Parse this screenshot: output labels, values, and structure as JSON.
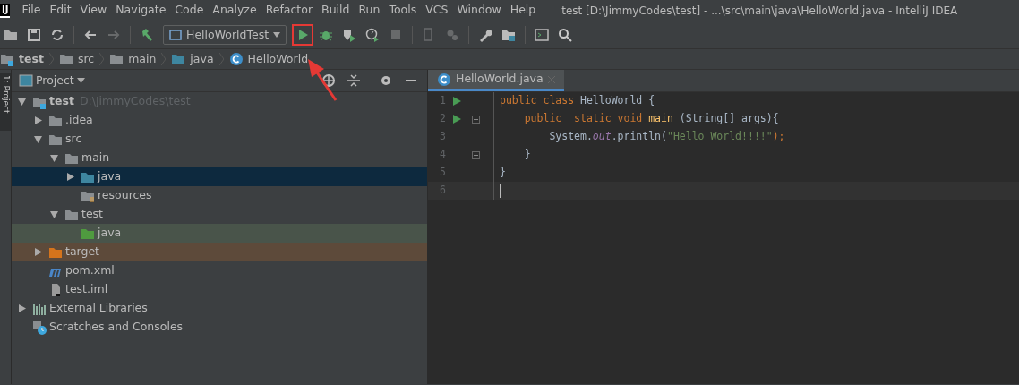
{
  "app_icon": {
    "text": "IJ"
  },
  "menu": [
    {
      "label": "File"
    },
    {
      "label": "Edit"
    },
    {
      "label": "View"
    },
    {
      "label": "Navigate"
    },
    {
      "label": "Code"
    },
    {
      "label": "Analyze"
    },
    {
      "label": "Refactor"
    },
    {
      "label": "Build"
    },
    {
      "label": "Run"
    },
    {
      "label": "Tools"
    },
    {
      "label": "VCS"
    },
    {
      "label": "Window"
    },
    {
      "label": "Help"
    }
  ],
  "window": {
    "title": "test [D:\\JimmyCodes\\test] - ...\\src\\main\\java\\HelloWorld.java - IntelliJ IDEA"
  },
  "toolbar": [
    {
      "kind": "open",
      "disabled": false
    },
    {
      "kind": "save",
      "disabled": false
    },
    {
      "kind": "sync",
      "disabled": false
    },
    {
      "kind": "sep"
    },
    {
      "kind": "back",
      "disabled": false
    },
    {
      "kind": "forward",
      "disabled": true
    },
    {
      "kind": "sep"
    },
    {
      "kind": "build",
      "disabled": false
    },
    {
      "kind": "config",
      "label": "HelloWorldTest"
    },
    {
      "kind": "run",
      "disabled": false,
      "highlighted": true
    },
    {
      "kind": "debug",
      "disabled": false
    },
    {
      "kind": "coverage",
      "disabled": false
    },
    {
      "kind": "profile",
      "disabled": false
    },
    {
      "kind": "stop",
      "disabled": true
    },
    {
      "kind": "sep"
    },
    {
      "kind": "device",
      "disabled": true
    },
    {
      "kind": "attach",
      "disabled": true
    },
    {
      "kind": "sep"
    },
    {
      "kind": "wrench",
      "disabled": false
    },
    {
      "kind": "structure",
      "disabled": false
    },
    {
      "kind": "sep"
    },
    {
      "kind": "terminal",
      "disabled": false
    },
    {
      "kind": "search",
      "disabled": false
    }
  ],
  "breadcrumbs": [
    {
      "label": "test",
      "kind": "module"
    },
    {
      "label": "src",
      "kind": "folder"
    },
    {
      "label": "main",
      "kind": "folder"
    },
    {
      "label": "java",
      "kind": "source"
    },
    {
      "label": "HelloWorld",
      "kind": "class"
    }
  ],
  "side_tab": {
    "label": "1: Project"
  },
  "project_panel": {
    "title": "Project",
    "tree": [
      {
        "label": "test",
        "path": "D:\\JimmyCodes\\test",
        "kind": "module",
        "expanded": true,
        "selected": false,
        "children": [
          {
            "label": ".idea",
            "kind": "folder",
            "expanded": false,
            "selected": false
          },
          {
            "label": "src",
            "kind": "folder",
            "expanded": true,
            "selected": false,
            "children": [
              {
                "label": "main",
                "kind": "folder",
                "expanded": true,
                "selected": false,
                "children": [
                  {
                    "label": "java",
                    "kind": "source",
                    "expanded": false,
                    "selected": true
                  },
                  {
                    "label": "resources",
                    "kind": "resources",
                    "selected": false
                  }
                ]
              },
              {
                "label": "test",
                "kind": "folder",
                "expanded": true,
                "selected": false,
                "children": [
                  {
                    "label": "java",
                    "kind": "test",
                    "selected": false
                  }
                ]
              }
            ]
          },
          {
            "label": "target",
            "kind": "excluded",
            "expanded": false,
            "selected": false
          },
          {
            "label": "pom.xml",
            "kind": "maven",
            "selected": false
          },
          {
            "label": "test.iml",
            "kind": "iml",
            "selected": false
          }
        ]
      },
      {
        "label": "External Libraries",
        "kind": "libraries",
        "expanded": false,
        "selected": false
      },
      {
        "label": "Scratches and Consoles",
        "kind": "scratches",
        "selected": false
      }
    ]
  },
  "editor": {
    "tabs": [
      {
        "label": "HelloWorld.java",
        "selected": true
      }
    ],
    "lines": [
      {
        "number": "1",
        "run": true,
        "fold": false,
        "current": false,
        "tokens": [
          {
            "t": "public ",
            "kind": "kw"
          },
          {
            "t": "class ",
            "kind": "kw"
          },
          {
            "t": "HelloWorld {",
            "kind": "plain"
          }
        ]
      },
      {
        "number": "2",
        "run": true,
        "fold": true,
        "current": false,
        "tokens": [
          {
            "t": "    public  ",
            "kind": "kw"
          },
          {
            "t": "static ",
            "kind": "kw"
          },
          {
            "t": "void ",
            "kind": "kw"
          },
          {
            "t": "main",
            "kind": "method"
          },
          {
            "t": " (String[] args){",
            "kind": "plain"
          }
        ]
      },
      {
        "number": "3",
        "run": false,
        "fold": false,
        "current": false,
        "tokens": [
          {
            "t": "        System.",
            "kind": "plain"
          },
          {
            "t": "out",
            "kind": "field"
          },
          {
            "t": ".println(",
            "kind": "plain"
          },
          {
            "t": "\"Hello World!!!!\"",
            "kind": "string"
          },
          {
            "t": ");",
            "kind": "punct"
          }
        ]
      },
      {
        "number": "4",
        "run": false,
        "fold": true,
        "current": false,
        "tokens": [
          {
            "t": "    }",
            "kind": "plain"
          }
        ]
      },
      {
        "number": "5",
        "run": false,
        "fold": false,
        "current": false,
        "tokens": [
          {
            "t": "}",
            "kind": "plain"
          }
        ]
      },
      {
        "number": "6",
        "run": false,
        "fold": false,
        "current": true
      }
    ]
  }
}
